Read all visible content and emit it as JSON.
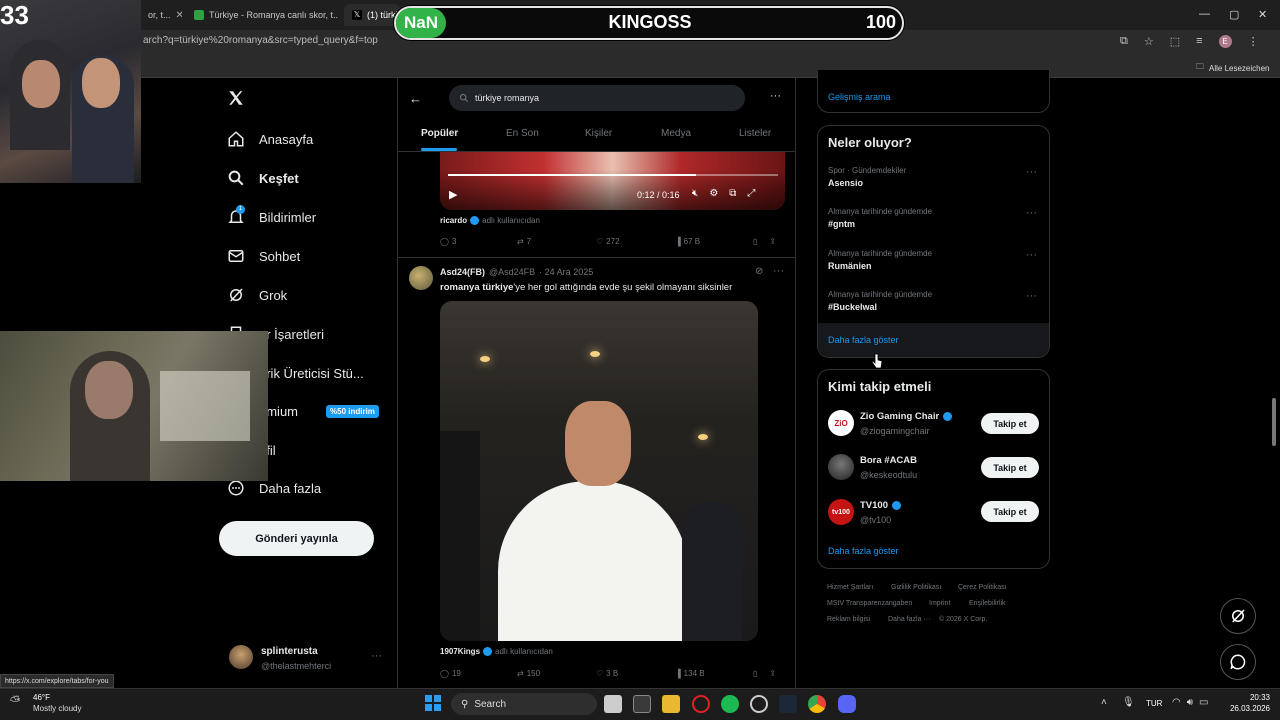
{
  "browser": {
    "tabs": [
      {
        "label": "or, t..."
      },
      {
        "label": "Türkiye - Romanya canlı skor, t..."
      },
      {
        "label": "(1) türki..."
      }
    ],
    "url": "arch?q=türkiye%20romanya&src=typed_query&f=top",
    "bookmarks_folder": "Alle Lesezeichen",
    "status_url": "https://x.com/explore/tabs/for-you"
  },
  "overlay": {
    "left_badge": "NaN",
    "streamer": "KINGOSS",
    "score": "100",
    "corner_text": "33"
  },
  "nav": {
    "items": [
      {
        "label": "Anasayfa",
        "icon": "home-icon"
      },
      {
        "label": "Keşfet",
        "icon": "search-icon"
      },
      {
        "label": "Bildirimler",
        "icon": "bell-icon",
        "badge": "1"
      },
      {
        "label": "Sohbet",
        "icon": "mail-icon"
      },
      {
        "label": "Grok",
        "icon": "grok-icon"
      },
      {
        "label": "er İşaretleri",
        "icon": "bookmark-icon"
      },
      {
        "label": "erik Üreticisi Stü...",
        "icon": "studio-icon"
      },
      {
        "label": "emium",
        "icon": "premium-icon",
        "tag": "%50 indirim"
      },
      {
        "label": "ofil",
        "icon": "profile-icon"
      },
      {
        "label": "Daha fazla",
        "icon": "more-icon"
      }
    ],
    "post_button": "Gönderi yayınla",
    "user": {
      "name": "splinterusta",
      "handle": "@thelastmehterci"
    }
  },
  "search": {
    "query": "türkiye romanya",
    "tabs": [
      "Popüler",
      "En Son",
      "Kişiler",
      "Medya",
      "Listeler"
    ]
  },
  "tweet1": {
    "video_time": "0:12 / 0:16",
    "attribution_name": "ricardo",
    "attribution_suffix": "adlı kullanıcıdan",
    "replies": "3",
    "reposts": "7",
    "likes": "272",
    "views": "67 B"
  },
  "tweet2": {
    "name": "Asd24(FB)",
    "handle": "@Asd24FB",
    "date": "· 24 Ara 2025",
    "text_bold": "romanya türkiye",
    "text_rest": "'ye her gol attığında evde şu şekil olmayanı siksinler",
    "attribution_name": "1907Kings",
    "attribution_suffix": "adlı kullanıcıdan",
    "replies": "19",
    "reposts": "150",
    "likes": "3 B",
    "views": "134 B"
  },
  "right": {
    "advanced_search": "Gelişmiş arama",
    "trends_title": "Neler oluyor?",
    "trends": [
      {
        "category": "Spor · Gündemdekiler",
        "name": "Asensio"
      },
      {
        "category": "Almanya tarihinde gündemde",
        "name": "#gntm"
      },
      {
        "category": "Almanya tarihinde gündemde",
        "name": "Rumänien"
      },
      {
        "category": "Almanya tarihinde gündemde",
        "name": "#Buckelwal"
      }
    ],
    "show_more": "Daha fazla göster",
    "follow_title": "Kimi takip etmeli",
    "suggestions": [
      {
        "name": "Zio Gaming Chair",
        "handle": "@ziogamingchair",
        "verified": true,
        "button": "Takip et"
      },
      {
        "name": "Bora #ACAB",
        "handle": "@keskeodtulu",
        "verified": false,
        "button": "Takip et"
      },
      {
        "name": "TV100",
        "handle": "@tv100",
        "verified": true,
        "button": "Takip et"
      }
    ],
    "follow_more": "Daha fazla göster",
    "footer": [
      "Hizmet Şartları",
      "Gizlilik Politikası",
      "Çerez Politikası",
      "MStV Transparenzangaben",
      "Imprint",
      "Erişilebilirlik",
      "Reklam bilgisi",
      "Daha fazla ···",
      "© 2026 X Corp."
    ]
  },
  "taskbar": {
    "weather_temp": "46°F",
    "weather_desc": "Mostly cloudy",
    "search": "Search",
    "lang": "TUR",
    "time": "20:33",
    "date": "26.03.2026"
  }
}
